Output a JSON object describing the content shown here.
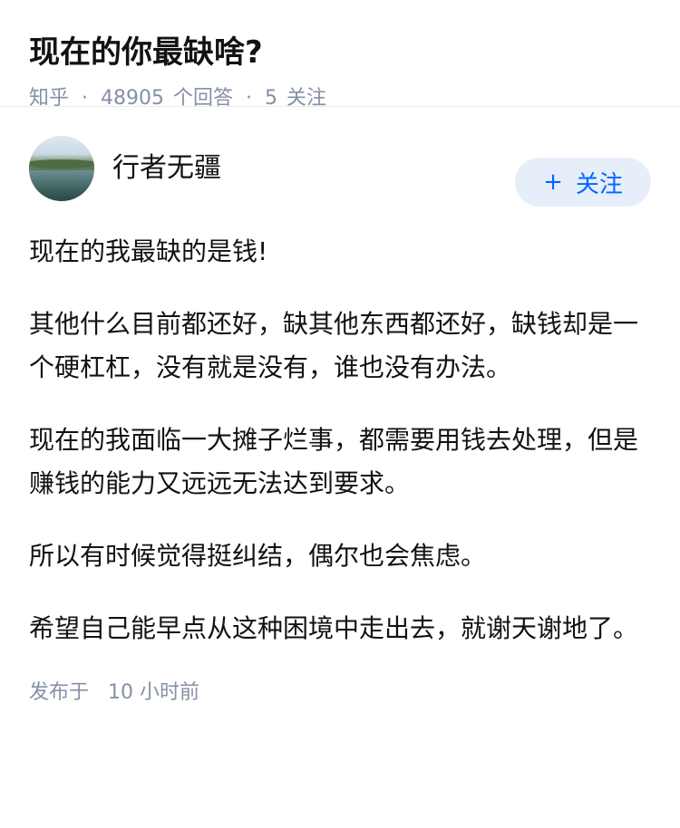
{
  "question": {
    "title": "现在的你最缺啥?",
    "meta": {
      "source": "知乎",
      "separator": "·",
      "answer_count": "48905",
      "answer_label": "个回答",
      "follow_count": "5",
      "follow_label": "关注"
    }
  },
  "answer": {
    "author": {
      "name": "行者无疆",
      "avatar_icon": "landscape-avatar"
    },
    "follow_button": {
      "icon": "+",
      "label": "关注"
    },
    "paragraphs": [
      "现在的我最缺的是钱!",
      "其他什么目前都还好，缺其他东西都还好，缺钱却是一个硬杠杠，没有就是没有，谁也没有办法。",
      "现在的我面临一大摊子烂事，都需要用钱去处理，但是赚钱的能力又远远无法达到要求。",
      "所以有时候觉得挺纠结，偶尔也会焦虑。",
      "希望自己能早点从这种困境中走出去，就谢天谢地了。"
    ],
    "published": {
      "label": "发布于",
      "time": "10 小时前"
    }
  },
  "colors": {
    "text": "#121212",
    "meta": "#8590a6",
    "accent": "#0066ff",
    "button_bg": "#e6eef9"
  }
}
